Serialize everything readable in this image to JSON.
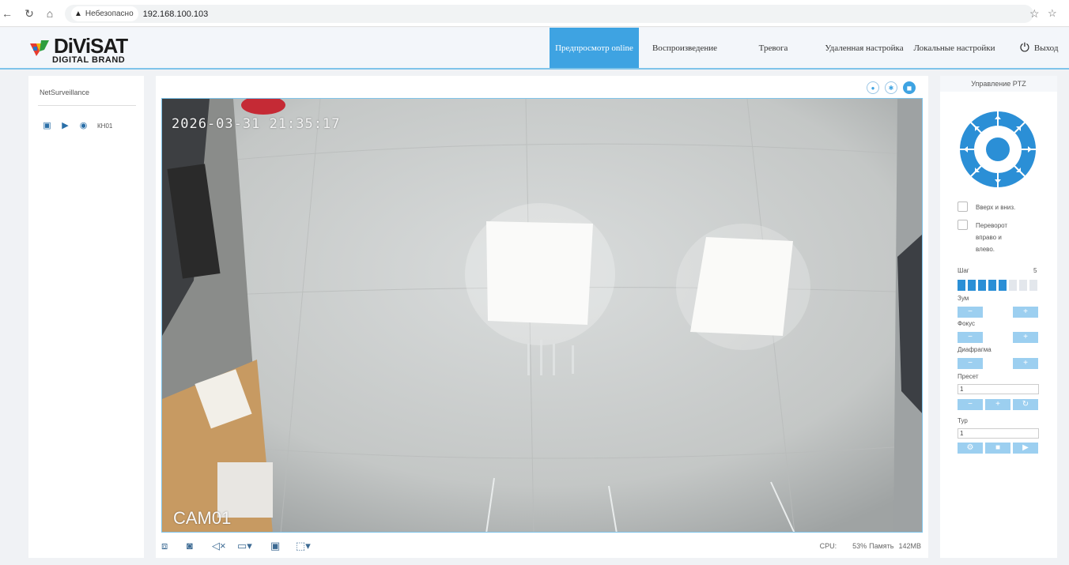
{
  "browser": {
    "security_label": "Небезопасно",
    "url": "192.168.100.103"
  },
  "header": {
    "logo_word": "DiViSAT",
    "logo_sub": "DIGITAL BRAND",
    "nav": [
      {
        "label": "Предпросмотр online",
        "active": true
      },
      {
        "label": "Воспроизведение",
        "active": false
      },
      {
        "label": "Тревога",
        "active": false
      },
      {
        "label": "Удаленная настройка",
        "active": false
      },
      {
        "label": "Локальные настройки",
        "active": false
      }
    ],
    "logout_label": "Выход"
  },
  "left_panel": {
    "title": "NetSurveillance",
    "camera_label": "КН01"
  },
  "video": {
    "timestamp": "2026-03-31 21:35:17",
    "camera_name": "CAM01"
  },
  "stats": {
    "cpu_label": "CPU:",
    "cpu_value": "53%",
    "memory_label": "Память",
    "memory_value": "142MB"
  },
  "ptz": {
    "title": "Управление PTZ",
    "flip_vertical": "Вверх и вниз.",
    "flip_horizontal": "Переворот вправо и влево.",
    "step_label": "Шаг",
    "step_value": "5",
    "step_max": "8",
    "zoom_label": "Зум",
    "focus_label": "Фокус",
    "iris_label": "Диафрагма",
    "preset_label": "Пресет",
    "preset_value": "1",
    "tour_label": "Тур",
    "tour_value": "1"
  },
  "colors": {
    "accent": "#3ea3e2",
    "header_border": "#7fc4ea",
    "button": "#9ccff0"
  }
}
